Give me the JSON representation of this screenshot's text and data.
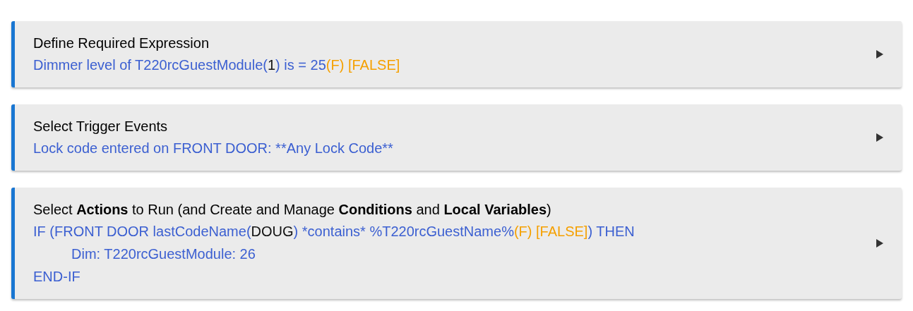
{
  "sections": [
    {
      "title": "Define Required Expression",
      "lines": [
        {
          "segments": [
            {
              "kind": "value",
              "text": "Dimmer level of T220rcGuestModule("
            },
            {
              "kind": "state",
              "text": "1"
            },
            {
              "kind": "value",
              "text": ") is = 25"
            },
            {
              "kind": "eval",
              "text": "(F) [FALSE]"
            }
          ]
        }
      ]
    },
    {
      "title": "Select Trigger Events",
      "lines": [
        {
          "segments": [
            {
              "kind": "value",
              "text": "Lock code entered on FRONT DOOR: **Any Lock Code**"
            }
          ]
        }
      ]
    },
    {
      "title": "Select **Actions** to Run (and Create and Manage **Conditions** and **Local Variables**)",
      "lines": [
        {
          "segments": [
            {
              "kind": "value",
              "text": "IF (FRONT DOOR lastCodeName("
            },
            {
              "kind": "state",
              "text": "DOUG"
            },
            {
              "kind": "value",
              "text": ") *contains* %T220rcGuestName%"
            },
            {
              "kind": "eval",
              "text": "(F) [FALSE]"
            },
            {
              "kind": "value",
              "text": ") THEN"
            }
          ],
          "children": [
            {
              "segments": [
                {
                  "kind": "value",
                  "text": "Dim: T220rcGuestModule: 26"
                }
              ]
            }
          ]
        },
        {
          "segments": [
            {
              "kind": "value",
              "text": "END-IF"
            }
          ]
        }
      ]
    }
  ]
}
